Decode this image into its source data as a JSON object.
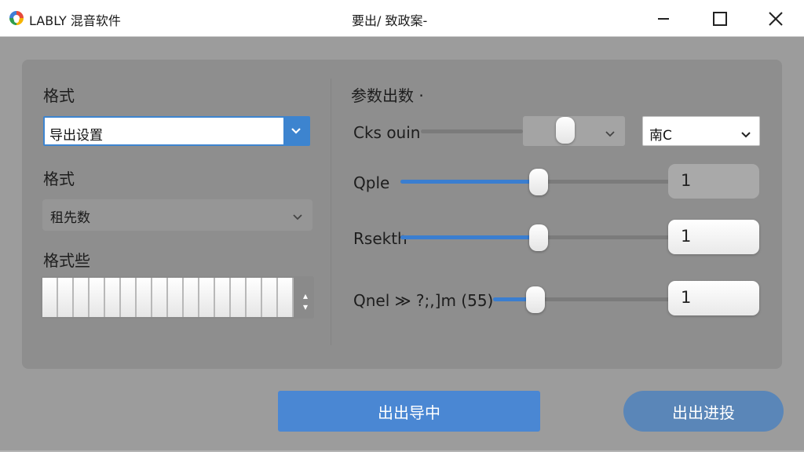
{
  "window": {
    "app_title": "LABLY 混音软件",
    "center_title": "要出/  致政案-",
    "minimize_icon": "minimize-icon",
    "maximize_icon": "maximize-icon",
    "close_icon": "close-icon"
  },
  "left": {
    "label_1": "格式",
    "dropdown_1_value": "导出设置",
    "label_2": "格式",
    "dropdown_2_value": "租先数",
    "label_3": "格式些"
  },
  "right": {
    "section_title": "参数出数 ·",
    "rows": [
      {
        "label": "Cks ouin",
        "value": 0.86,
        "combo_value": "南C"
      },
      {
        "label": "Qple",
        "value": 0.51,
        "number": "1"
      },
      {
        "label": "Rsekth",
        "value": 0.51,
        "number": "1"
      },
      {
        "label": "Qnel  ≫  ?;,]m (55)",
        "value": 0.24,
        "number": "1"
      }
    ]
  },
  "buttons": {
    "primary_label": "出出导中",
    "secondary_label": "出出进投"
  },
  "colors": {
    "accent": "#3d84cf",
    "primary_button": "#4a87d3",
    "secondary_button": "#5a86b8",
    "panel": "#8e8e8e",
    "background": "#9c9c9c"
  }
}
